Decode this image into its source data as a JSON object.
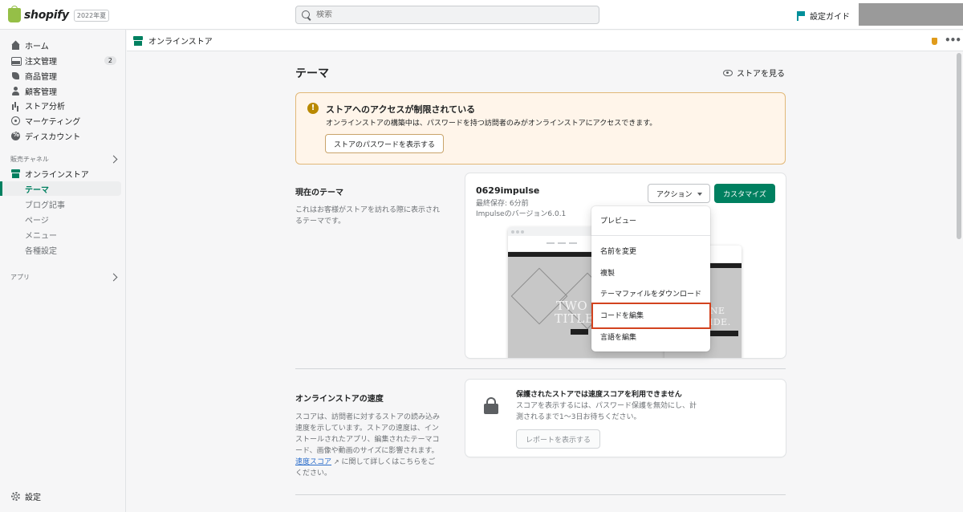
{
  "topbar": {
    "logo_text": "shopify",
    "logo_badge": "2022年夏",
    "search_placeholder": "検索",
    "guide_label": "設定ガイド"
  },
  "sidebar": {
    "items": [
      {
        "label": "ホーム",
        "icon": "home-icon"
      },
      {
        "label": "注文管理",
        "icon": "orders-icon",
        "badge": "2"
      },
      {
        "label": "商品管理",
        "icon": "tag-icon"
      },
      {
        "label": "顧客管理",
        "icon": "person-icon"
      },
      {
        "label": "ストア分析",
        "icon": "bar-chart-icon"
      },
      {
        "label": "マーケティング",
        "icon": "target-icon"
      },
      {
        "label": "ディスカウント",
        "icon": "discount-icon"
      }
    ],
    "sales_channel_label": "販売チャネル",
    "online_store_label": "オンラインストア",
    "sub_items": [
      "テーマ",
      "ブログ記事",
      "ページ",
      "メニュー",
      "各種設定"
    ],
    "apps_label": "アプリ",
    "settings_label": "設定"
  },
  "subheader": {
    "title": "オンラインストア"
  },
  "main": {
    "page_title": "テーマ",
    "view_store_label": "ストアを見る",
    "banner": {
      "title": "ストアへのアクセスが制限されている",
      "text": "オンラインストアの構築中は、パスワードを持つ訪問者のみがオンラインストアにアクセスできます。",
      "button": "ストアのパスワードを表示する"
    },
    "current_theme": {
      "section_title": "現在のテーマ",
      "section_desc_1": "これはお客様がストアを訪れる際に表示され",
      "section_desc_2": "るテーマです。",
      "name": "0629impulse",
      "last_saved": "最終保存: 6分前",
      "version": "Impulseのバージョン6.0.1",
      "action_label": "アクション",
      "customize_label": "カスタマイズ",
      "preview_text_1": "TWO",
      "preview_text_2": "TITLE",
      "preview_text_mobile_1": "INE",
      "preview_text_mobile_2": "IDE."
    },
    "menu": {
      "items": [
        "プレビュー",
        "名前を変更",
        "複製",
        "テーマファイルをダウンロード",
        "コードを編集",
        "言語を編集"
      ],
      "accent_color": "#d3431f"
    },
    "speed": {
      "section_title": "オンラインストアの速度",
      "desc_1": "スコアは、訪問者に対するストアの読み込み",
      "desc_2": "速度を示しています。ストアの速度は、イン",
      "desc_3": "ストールされたアプリ、編集されたテーマコ",
      "desc_4": "ード、画像や動画のサイズに影響されます。",
      "desc_link": "速度スコア",
      "desc_5": "に関して詳しくはこちらをご",
      "desc_6": "ください。",
      "card_title": "保護されたストアでは速度スコアを利用できません",
      "card_text_1": "スコアを表示するには、パスワード保護を無効にし、計",
      "card_text_2": "測されるまで1〜3日お待ちください。",
      "report_button": "レポートを表示する"
    }
  },
  "colors": {
    "brand_green": "#008060",
    "logo_green": "#95bf47",
    "warning": "#b98900",
    "banner_bg": "#fff5ea"
  }
}
